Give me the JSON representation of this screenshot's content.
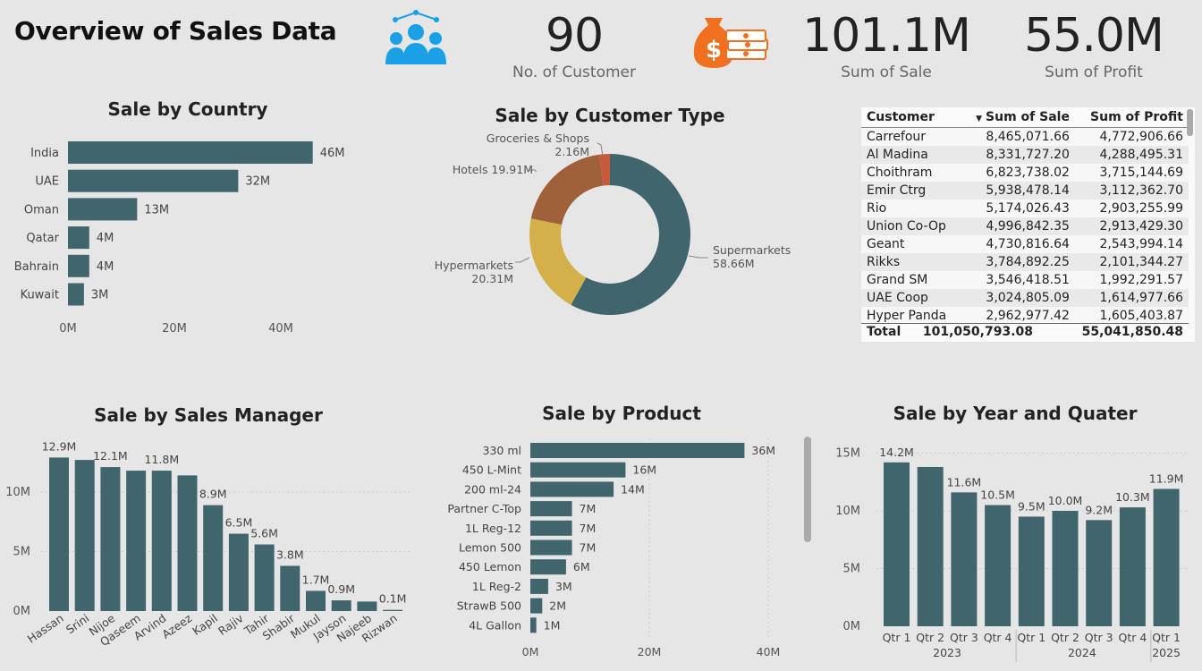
{
  "header": {
    "title": "Overview of Sales Data",
    "kpis": [
      {
        "value": "90",
        "label": "No. of Customer"
      },
      {
        "value": "101.1M",
        "label": "Sum of Sale"
      },
      {
        "value": "55.0M",
        "label": "Sum of Profit"
      }
    ]
  },
  "icons": {
    "customers": "people-group-icon",
    "money": "money-bag-icon"
  },
  "colors": {
    "bar": "#40656c",
    "supermarkets": "#40656c",
    "hypermarkets": "#d4b04a",
    "hotels": "#a0603a",
    "groceries": "#c65a3a",
    "accent_icon": "#1aa0e6",
    "money_icon": "#f07020"
  },
  "chart_data": [
    {
      "id": "country",
      "type": "bar",
      "orientation": "horizontal",
      "title": "Sale by Country",
      "categories": [
        "India",
        "UAE",
        "Oman",
        "Qatar",
        "Bahrain",
        "Kuwait"
      ],
      "values": [
        46,
        32,
        13,
        4,
        4,
        3
      ],
      "value_labels": [
        "46M",
        "32M",
        "13M",
        "4M",
        "4M",
        "3M"
      ],
      "xticks": [
        "0M",
        "20M",
        "40M"
      ],
      "xlim": [
        0,
        50
      ]
    },
    {
      "id": "customer_type",
      "type": "pie",
      "style": "donut",
      "title": "Sale by Customer Type",
      "slices": [
        {
          "name": "Supermarkets",
          "value": 58.66,
          "label": "Supermarkets",
          "value_label": "58.66M"
        },
        {
          "name": "Hypermarkets",
          "value": 20.31,
          "label": "Hypermarkets",
          "value_label": "20.31M"
        },
        {
          "name": "Hotels",
          "value": 19.91,
          "label": "Hotels 19.91M",
          "value_label": ""
        },
        {
          "name": "Groceries & Shops",
          "value": 2.16,
          "label": "Groceries & Shops",
          "value_label": "2.16M"
        }
      ]
    },
    {
      "id": "customer_table",
      "type": "table",
      "columns": [
        "Customer",
        "Sum of Sale",
        "Sum of Profit"
      ],
      "rows": [
        [
          "Carrefour",
          "8,465,071.66",
          "4,772,906.66"
        ],
        [
          "Al Madina",
          "8,331,727.20",
          "4,288,495.31"
        ],
        [
          "Choithram",
          "6,823,738.02",
          "3,715,144.69"
        ],
        [
          "Emir Ctrg",
          "5,938,478.14",
          "3,112,362.70"
        ],
        [
          "Rio",
          "5,174,026.43",
          "2,903,255.99"
        ],
        [
          "Union Co-Op",
          "4,996,842.35",
          "2,913,429.30"
        ],
        [
          "Geant",
          "4,730,816.64",
          "2,543,994.14"
        ],
        [
          "Rikks",
          "3,784,892.25",
          "2,101,344.27"
        ],
        [
          "Grand SM",
          "3,546,418.51",
          "1,992,291.57"
        ],
        [
          "UAE Coop",
          "3,024,805.09",
          "1,614,977.66"
        ],
        [
          "Hyper Panda",
          "2,962,977.42",
          "1,605,403.87"
        ]
      ],
      "total": [
        "Total",
        "101,050,793.08",
        "55,041,850.48"
      ]
    },
    {
      "id": "manager",
      "type": "bar",
      "orientation": "vertical",
      "title": "Sale by Sales Manager",
      "categories": [
        "Hassan",
        "Srini",
        "Nijoe",
        "Qaseem",
        "Arvind",
        "Azeez",
        "Kapil",
        "Rajiv",
        "Tahir",
        "Shabir",
        "Mukul",
        "Jayson",
        "Najeeb",
        "Rizwan"
      ],
      "values": [
        12.9,
        12.7,
        12.1,
        11.8,
        11.8,
        11.4,
        8.9,
        6.5,
        5.6,
        3.8,
        1.7,
        0.9,
        0.8,
        0.1
      ],
      "value_labels": [
        "12.9M",
        "",
        "12.1M",
        "",
        "11.8M",
        "",
        "8.9M",
        "6.5M",
        "5.6M",
        "3.8M",
        "1.7M",
        "0.9M",
        "",
        "0.1M"
      ],
      "yticks": [
        "0M",
        "5M",
        "10M"
      ],
      "ylim": [
        0,
        14
      ]
    },
    {
      "id": "product",
      "type": "bar",
      "orientation": "horizontal",
      "title": "Sale by Product",
      "categories": [
        "330 ml",
        "450 L-Mint",
        "200 ml-24",
        "Partner C-Top",
        "1L Reg-12",
        "Lemon 500",
        "450 Lemon",
        "1L Reg-2",
        "StrawB 500",
        "4L Gallon"
      ],
      "values": [
        36,
        16,
        14,
        7,
        7,
        7,
        6,
        3,
        2,
        1
      ],
      "value_labels": [
        "36M",
        "16M",
        "14M",
        "7M",
        "7M",
        "7M",
        "6M",
        "3M",
        "2M",
        "1M"
      ],
      "xticks": [
        "0M",
        "20M",
        "40M"
      ],
      "xlim": [
        0,
        40
      ]
    },
    {
      "id": "year_quarter",
      "type": "bar",
      "orientation": "vertical",
      "title": "Sale by Year and Quater",
      "categories": [
        "Qtr 1",
        "Qtr 2",
        "Qtr 3",
        "Qtr 4",
        "Qtr 1",
        "Qtr 2",
        "Qtr 3",
        "Qtr 4",
        "Qtr 1"
      ],
      "groups": [
        {
          "label": "2023",
          "count": 4
        },
        {
          "label": "2024",
          "count": 4
        },
        {
          "label": "2025",
          "count": 1
        }
      ],
      "values": [
        14.2,
        13.8,
        11.6,
        10.5,
        9.5,
        10.0,
        9.2,
        10.3,
        11.9
      ],
      "value_labels": [
        "14.2M",
        "",
        "11.6M",
        "10.5M",
        "9.5M",
        "10.0M",
        "9.2M",
        "10.3M",
        "11.9M"
      ],
      "yticks": [
        "0M",
        "5M",
        "10M",
        "15M"
      ],
      "ylim": [
        0,
        16
      ]
    }
  ]
}
